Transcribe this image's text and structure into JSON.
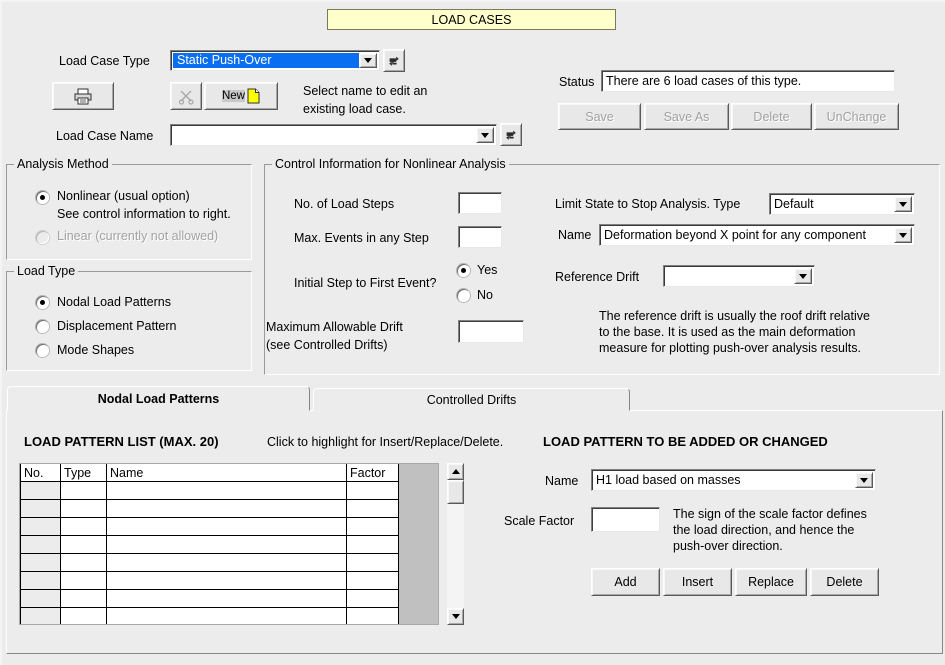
{
  "window": {
    "banner_title": "LOAD CASES",
    "banner_bg": "#ffffcc"
  },
  "top": {
    "load_case_type_label": "Load Case Type",
    "load_case_type_value": "Static Push-Over",
    "load_case_type_selected_bg": "#0a6ef0",
    "refresh_type_icon": "refresh-icon",
    "print_icon": "printer-icon",
    "cut_icon": "scissors-icon",
    "new_button_label": "New",
    "new_button_icon": "new-page-icon",
    "hint_line1": "Select name to edit an",
    "hint_line2": "existing load case.",
    "load_case_name_label": "Load Case Name",
    "load_case_name_value": "",
    "refresh_name_icon": "refresh-icon",
    "status_label": "Status",
    "status_value": "There are 6 load cases of this type.",
    "buttons": [
      {
        "label": "Save",
        "enabled": false
      },
      {
        "label": "Save As",
        "enabled": false
      },
      {
        "label": "Delete",
        "enabled": false
      },
      {
        "label": "UnChange",
        "enabled": false
      }
    ]
  },
  "analysis_method": {
    "title": "Analysis Method",
    "options": [
      {
        "label": "Nonlinear (usual option)",
        "selected": true,
        "enabled": true
      },
      {
        "label": "Linear (currently not allowed)",
        "selected": false,
        "enabled": false
      }
    ],
    "note": "See control information to right."
  },
  "load_type": {
    "title": "Load Type",
    "options": [
      {
        "label": "Nodal Load Patterns",
        "selected": true
      },
      {
        "label": "Displacement Pattern",
        "selected": false
      },
      {
        "label": "Mode Shapes",
        "selected": false
      }
    ]
  },
  "control_info": {
    "title": "Control Information for Nonlinear Analysis",
    "load_steps_label": "No. of Load Steps",
    "load_steps_value": "",
    "max_events_label": "Max. Events in any Step",
    "max_events_value": "",
    "initial_step_label": "Initial Step to First Event?",
    "initial_step_yes": "Yes",
    "initial_step_no": "No",
    "initial_step_selected": "Yes",
    "max_drift_label_line1": "Maximum Allowable Drift",
    "max_drift_label_line2": "(see Controlled Drifts)",
    "max_drift_value": "",
    "limit_state_label": "Limit State to Stop Analysis.  Type",
    "limit_state_type_value": "Default",
    "limit_state_name_label": "Name",
    "limit_state_name_value": "Deformation beyond X point for any component",
    "reference_drift_label": "Reference Drift",
    "reference_drift_value": "",
    "reference_drift_help": "The reference drift is usually the roof drift relative\nto the base.  It is used as the main deformation\nmeasure for plotting push-over analysis results."
  },
  "tabs": [
    {
      "label": "Nodal Load Patterns",
      "active": true
    },
    {
      "label": "Controlled Drifts",
      "active": false
    }
  ],
  "pattern_list": {
    "heading": "LOAD PATTERN LIST (MAX. 20)",
    "hint": "Click to highlight for Insert/Replace/Delete.",
    "columns": [
      "No.",
      "Type",
      "Name",
      "Factor"
    ],
    "rows": [
      {
        "no": "",
        "type": "",
        "name": "",
        "factor": ""
      },
      {
        "no": "",
        "type": "",
        "name": "",
        "factor": ""
      },
      {
        "no": "",
        "type": "",
        "name": "",
        "factor": ""
      },
      {
        "no": "",
        "type": "",
        "name": "",
        "factor": ""
      },
      {
        "no": "",
        "type": "",
        "name": "",
        "factor": ""
      },
      {
        "no": "",
        "type": "",
        "name": "",
        "factor": ""
      },
      {
        "no": "",
        "type": "",
        "name": "",
        "factor": ""
      },
      {
        "no": "",
        "type": "",
        "name": "",
        "factor": ""
      },
      {
        "no": "",
        "type": "",
        "name": "",
        "factor": ""
      }
    ],
    "scroll_up_icon": "scroll-up-arrow-icon",
    "scroll_down_icon": "scroll-down-arrow-icon"
  },
  "pattern_editor": {
    "heading": "LOAD PATTERN TO BE ADDED OR CHANGED",
    "name_label": "Name",
    "name_value": "H1 load based on masses",
    "scale_factor_label": "Scale Factor",
    "scale_factor_value": "",
    "scale_factor_help": "The sign of the scale factor defines\nthe load direction, and hence the\npush-over direction.",
    "buttons": [
      {
        "label": "Add"
      },
      {
        "label": "Insert"
      },
      {
        "label": "Replace"
      },
      {
        "label": "Delete"
      }
    ]
  }
}
